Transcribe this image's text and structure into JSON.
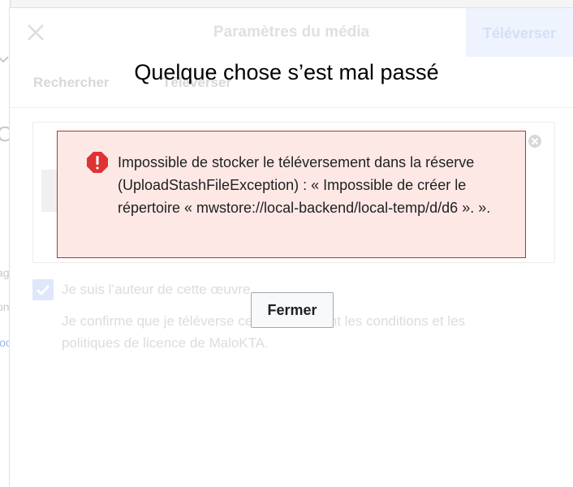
{
  "background": {
    "left_fragments": [
      "O",
      "I",
      "ag",
      "on",
      "loo"
    ]
  },
  "upload_dialog": {
    "title": "Paramètres du média",
    "upload_button": "Téléverser",
    "tabs": [
      {
        "label": "Rechercher"
      },
      {
        "label": "Téléverser"
      }
    ],
    "own_work_label": "Je suis l’auteur de cette œuvre",
    "own_work_description": "Je confirme que je téléverse ce fichier suivant les conditions et les politiques de licence de MaloKTA."
  },
  "message_dialog": {
    "title": "Quelque chose s’est mal passé",
    "error_text": "Impossible de stocker le téléversement dans la réserve (UploadStashFileException) : « Impossible de créer le répertoire « mwstore://local-backend/local-temp/d/d6 ». ».",
    "close_button": "Fermer"
  },
  "colors": {
    "error_border": "#b3342d",
    "error_background": "#fde8e6",
    "error_icon": "#d33"
  }
}
